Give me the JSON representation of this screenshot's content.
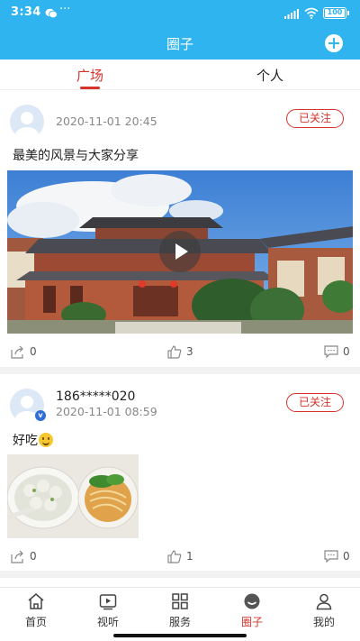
{
  "status_bar": {
    "time": "3:34",
    "more": "···",
    "battery": "100"
  },
  "header": {
    "title": "圈子",
    "add_icon": "plus-circle-icon"
  },
  "tabs": [
    {
      "label": "广场",
      "active": true
    },
    {
      "label": "个人",
      "active": false
    }
  ],
  "posts": [
    {
      "username": "",
      "time": "2020-11-01 20:45",
      "follow_label": "已关注",
      "text": "最美的风景与大家分享",
      "media": "video",
      "shares": "0",
      "likes": "3",
      "comments": "0"
    },
    {
      "username": "186*****020",
      "time": "2020-11-01 08:59",
      "follow_label": "已关注",
      "text": "好吃",
      "media": "image",
      "verified": true,
      "shares": "0",
      "likes": "1",
      "comments": "0"
    }
  ],
  "bottom_nav": [
    {
      "label": "首页",
      "icon": "home-icon",
      "active": false
    },
    {
      "label": "视听",
      "icon": "video-play-icon",
      "active": false
    },
    {
      "label": "服务",
      "icon": "grid-icon",
      "active": false
    },
    {
      "label": "圈子",
      "icon": "circle-chat-icon",
      "active": true
    },
    {
      "label": "我的",
      "icon": "person-icon",
      "active": false
    }
  ],
  "colors": {
    "brand": "#2fb4ef",
    "accent": "#d6332b"
  }
}
